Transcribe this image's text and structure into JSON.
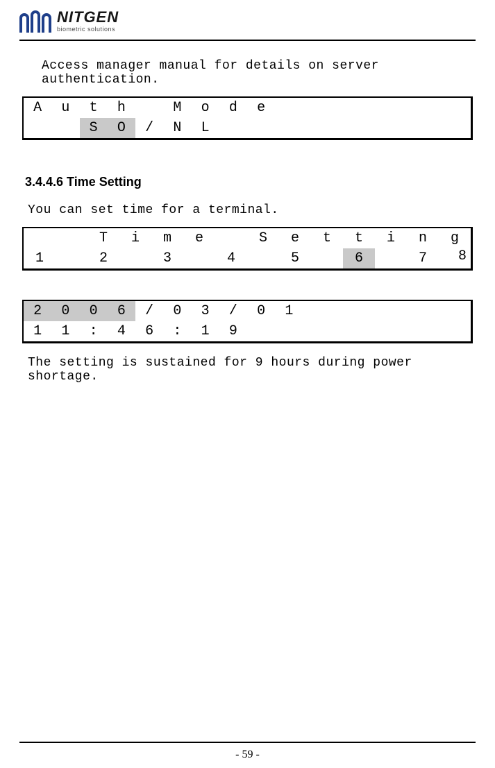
{
  "logo": {
    "main": "NITGEN",
    "sub": "biometric solutions"
  },
  "para1": "Access manager manual for details on server authentication.",
  "lcd1": {
    "row1": [
      {
        "t": "A"
      },
      {
        "t": "u"
      },
      {
        "t": "t"
      },
      {
        "t": "h"
      },
      {
        "t": ""
      },
      {
        "t": "M"
      },
      {
        "t": "o"
      },
      {
        "t": "d"
      },
      {
        "t": "e"
      },
      {
        "t": ""
      },
      {
        "t": ""
      },
      {
        "t": ""
      },
      {
        "t": ""
      },
      {
        "t": ""
      },
      {
        "t": ""
      },
      {
        "t": ""
      }
    ],
    "row2": [
      {
        "t": ""
      },
      {
        "t": ""
      },
      {
        "t": "S",
        "hl": true
      },
      {
        "t": "O",
        "hl": true
      },
      {
        "t": "/"
      },
      {
        "t": "N"
      },
      {
        "t": "L"
      },
      {
        "t": ""
      },
      {
        "t": ""
      },
      {
        "t": ""
      },
      {
        "t": ""
      },
      {
        "t": ""
      },
      {
        "t": ""
      },
      {
        "t": ""
      },
      {
        "t": ""
      },
      {
        "t": ""
      }
    ]
  },
  "heading": "3.4.4.6 Time Setting",
  "para2": "You can set time for a terminal.",
  "lcd2": {
    "row1": [
      {
        "t": ""
      },
      {
        "t": ""
      },
      {
        "t": "T"
      },
      {
        "t": "i"
      },
      {
        "t": "m"
      },
      {
        "t": "e"
      },
      {
        "t": ""
      },
      {
        "t": "S"
      },
      {
        "t": "e"
      },
      {
        "t": "t"
      },
      {
        "t": "t"
      },
      {
        "t": "i"
      },
      {
        "t": "n"
      },
      {
        "t": "g"
      }
    ],
    "row2": [
      {
        "t": "1"
      },
      {
        "t": ""
      },
      {
        "t": "2"
      },
      {
        "t": ""
      },
      {
        "t": "3"
      },
      {
        "t": ""
      },
      {
        "t": "4"
      },
      {
        "t": ""
      },
      {
        "t": "5"
      },
      {
        "t": ""
      },
      {
        "t": "6",
        "hl": true
      },
      {
        "t": ""
      },
      {
        "t": "7"
      },
      {
        "t": ""
      }
    ],
    "row2_extra": "8"
  },
  "lcd3": {
    "row1": [
      {
        "t": "2",
        "hl": true
      },
      {
        "t": "0",
        "hl": true
      },
      {
        "t": "0",
        "hl": true
      },
      {
        "t": "6",
        "hl": true
      },
      {
        "t": "/"
      },
      {
        "t": "0"
      },
      {
        "t": "3"
      },
      {
        "t": "/"
      },
      {
        "t": "0"
      },
      {
        "t": "1"
      },
      {
        "t": ""
      },
      {
        "t": ""
      },
      {
        "t": ""
      },
      {
        "t": ""
      },
      {
        "t": ""
      },
      {
        "t": ""
      }
    ],
    "row2": [
      {
        "t": "1"
      },
      {
        "t": "1"
      },
      {
        "t": ":"
      },
      {
        "t": "4"
      },
      {
        "t": "6"
      },
      {
        "t": ":"
      },
      {
        "t": "1"
      },
      {
        "t": "9"
      },
      {
        "t": ""
      },
      {
        "t": ""
      },
      {
        "t": ""
      },
      {
        "t": ""
      },
      {
        "t": ""
      },
      {
        "t": ""
      },
      {
        "t": ""
      },
      {
        "t": ""
      }
    ]
  },
  "para3": "The setting is sustained for 9 hours during power shortage.",
  "pagenum": "- 59 -"
}
